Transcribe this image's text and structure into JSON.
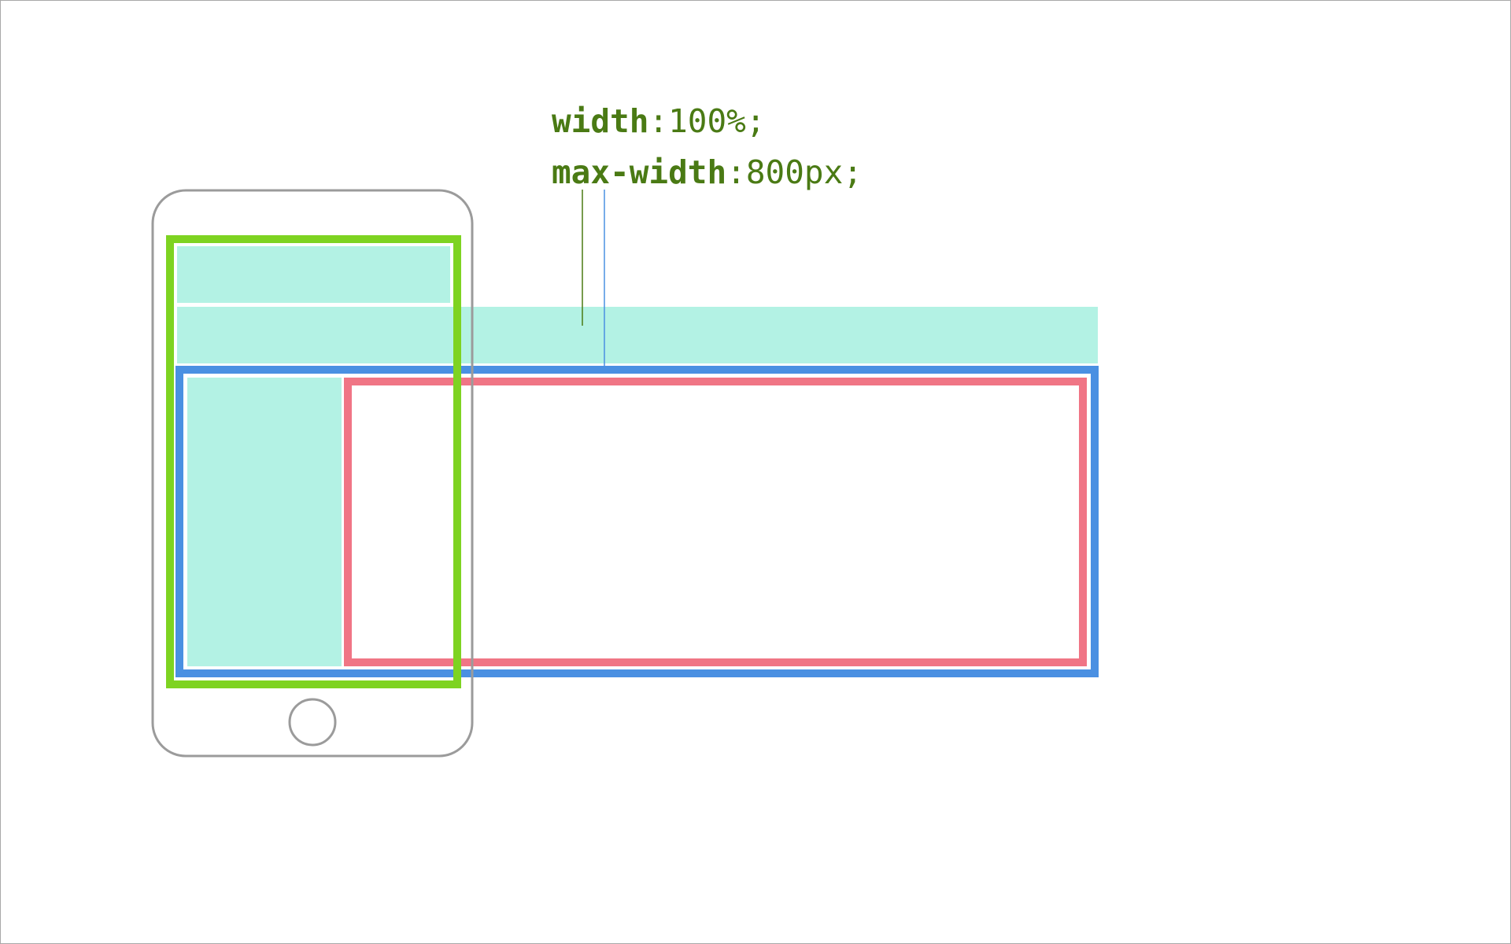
{
  "code": {
    "lines": [
      {
        "property": "width",
        "separator": ":",
        "value": "100%;"
      },
      {
        "property": "max-width",
        "separator": ":",
        "value": "800px;"
      }
    ]
  },
  "colors": {
    "text": "#4a7a14",
    "block_fill": "#b3f2e4",
    "phone_outline": "#9b9b9b",
    "container_100pct": "#7ed321",
    "container_max_width": "#4a90e2",
    "content_box": "#f07585",
    "leader_width": "#4a7a14",
    "leader_max_width": "#4a90e2"
  },
  "icons": {
    "phone": "smartphone-outline-icon",
    "home_button": "home-button-icon"
  }
}
